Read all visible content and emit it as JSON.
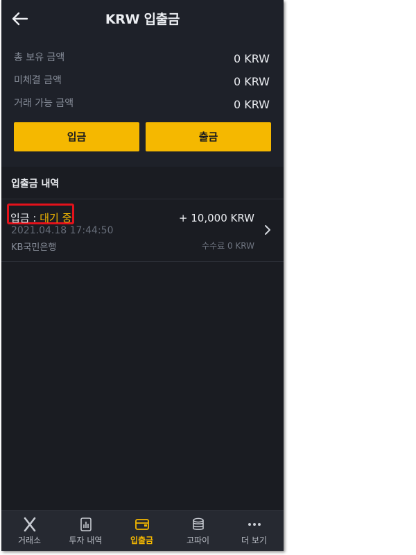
{
  "header": {
    "title": "KRW 입출금"
  },
  "summary": [
    {
      "label": "총 보유 금액",
      "value": "0 KRW"
    },
    {
      "label": "미체결 금액",
      "value": "0 KRW"
    },
    {
      "label": "거래 가능 금액",
      "value": "0 KRW"
    }
  ],
  "buttons": {
    "deposit": "입금",
    "withdraw": "출금"
  },
  "history": {
    "title": "입출금 내역",
    "items": [
      {
        "type": "입금 : ",
        "status": "대기 중",
        "amount": "+ 10,000 KRW",
        "datetime": "2021.04.18 17:44:50",
        "bank": "KB국민은행",
        "fee": "수수료 0 KRW"
      }
    ]
  },
  "tabs": [
    {
      "label": "거래소",
      "icon": "exchange-icon"
    },
    {
      "label": "투자 내역",
      "icon": "chart-icon"
    },
    {
      "label": "입출금",
      "icon": "wallet-icon",
      "active": true
    },
    {
      "label": "고파이",
      "icon": "coins-icon"
    },
    {
      "label": "더 보기",
      "icon": "more-icon"
    }
  ],
  "colors": {
    "accent": "#f5b800",
    "background": "#1e2129",
    "highlight": "#e3121b"
  }
}
